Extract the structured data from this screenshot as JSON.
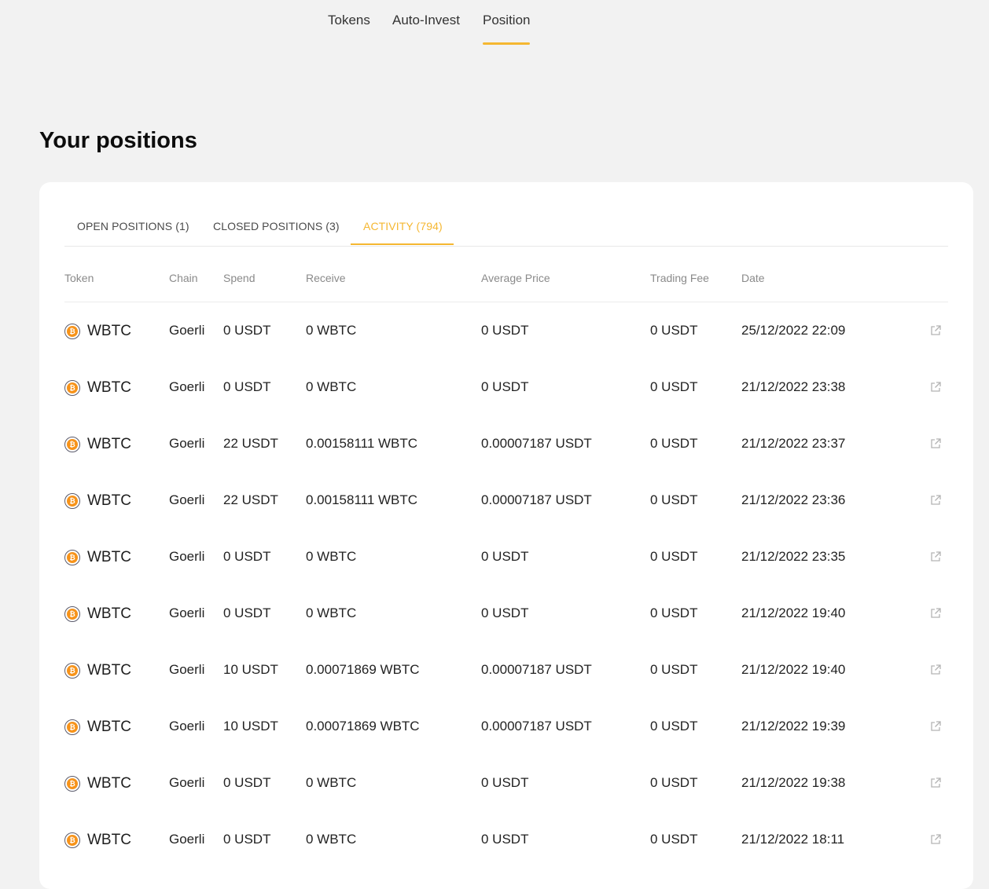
{
  "nav": {
    "items": [
      "Tokens",
      "Auto-Invest",
      "Position"
    ],
    "active_index": 2
  },
  "page_title": "Your positions",
  "tabs": [
    {
      "label": "OPEN POSITIONS (1)"
    },
    {
      "label": "CLOSED POSITIONS (3)"
    },
    {
      "label": "ACTIVITY (794)"
    }
  ],
  "active_tab": 2,
  "columns": [
    "Token",
    "Chain",
    "Spend",
    "Receive",
    "Average Price",
    "Trading Fee",
    "Date"
  ],
  "rows": [
    {
      "token": "WBTC",
      "chain": "Goerli",
      "spend": "0 USDT",
      "receive": "0 WBTC",
      "avg_price": "0 USDT",
      "fee": "0 USDT",
      "date": "25/12/2022 22:09"
    },
    {
      "token": "WBTC",
      "chain": "Goerli",
      "spend": "0 USDT",
      "receive": "0 WBTC",
      "avg_price": "0 USDT",
      "fee": "0 USDT",
      "date": "21/12/2022 23:38"
    },
    {
      "token": "WBTC",
      "chain": "Goerli",
      "spend": "22 USDT",
      "receive": "0.00158111 WBTC",
      "avg_price": "0.00007187 USDT",
      "fee": "0 USDT",
      "date": "21/12/2022 23:37"
    },
    {
      "token": "WBTC",
      "chain": "Goerli",
      "spend": "22 USDT",
      "receive": "0.00158111 WBTC",
      "avg_price": "0.00007187 USDT",
      "fee": "0 USDT",
      "date": "21/12/2022 23:36"
    },
    {
      "token": "WBTC",
      "chain": "Goerli",
      "spend": "0 USDT",
      "receive": "0 WBTC",
      "avg_price": "0 USDT",
      "fee": "0 USDT",
      "date": "21/12/2022 23:35"
    },
    {
      "token": "WBTC",
      "chain": "Goerli",
      "spend": "0 USDT",
      "receive": "0 WBTC",
      "avg_price": "0 USDT",
      "fee": "0 USDT",
      "date": "21/12/2022 19:40"
    },
    {
      "token": "WBTC",
      "chain": "Goerli",
      "spend": "10 USDT",
      "receive": "0.00071869 WBTC",
      "avg_price": "0.00007187 USDT",
      "fee": "0 USDT",
      "date": "21/12/2022 19:40"
    },
    {
      "token": "WBTC",
      "chain": "Goerli",
      "spend": "10 USDT",
      "receive": "0.00071869 WBTC",
      "avg_price": "0.00007187 USDT",
      "fee": "0 USDT",
      "date": "21/12/2022 19:39"
    },
    {
      "token": "WBTC",
      "chain": "Goerli",
      "spend": "0 USDT",
      "receive": "0 WBTC",
      "avg_price": "0 USDT",
      "fee": "0 USDT",
      "date": "21/12/2022 19:38"
    },
    {
      "token": "WBTC",
      "chain": "Goerli",
      "spend": "0 USDT",
      "receive": "0 WBTC",
      "avg_price": "0 USDT",
      "fee": "0 USDT",
      "date": "21/12/2022 18:11"
    }
  ],
  "icons": {
    "token_icon": "bitcoin-icon",
    "row_link_icon": "external-link-icon"
  },
  "colors": {
    "accent": "#f5b731",
    "btc": "#f7931a",
    "page_bg": "#f2f2f2",
    "card_bg": "#ffffff"
  }
}
